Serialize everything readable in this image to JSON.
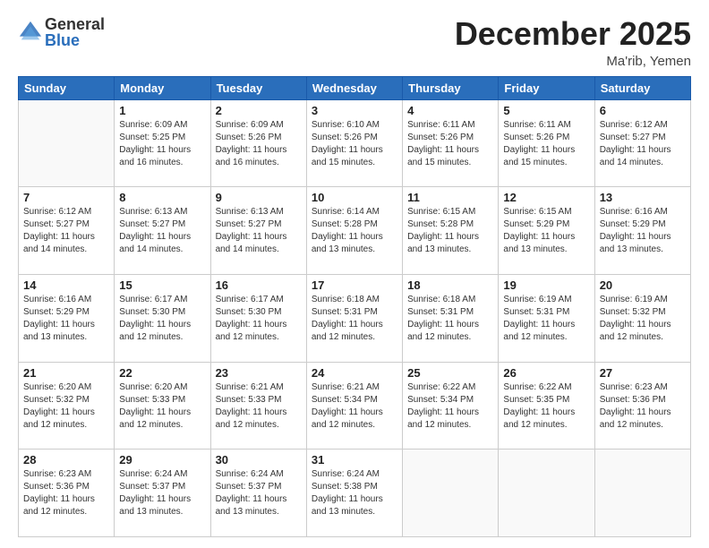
{
  "logo": {
    "general": "General",
    "blue": "Blue"
  },
  "title": "December 2025",
  "location": "Ma'rib, Yemen",
  "days_of_week": [
    "Sunday",
    "Monday",
    "Tuesday",
    "Wednesday",
    "Thursday",
    "Friday",
    "Saturday"
  ],
  "weeks": [
    [
      {
        "day": "",
        "sunrise": "",
        "sunset": "",
        "daylight": ""
      },
      {
        "day": "1",
        "sunrise": "Sunrise: 6:09 AM",
        "sunset": "Sunset: 5:25 PM",
        "daylight": "Daylight: 11 hours and 16 minutes."
      },
      {
        "day": "2",
        "sunrise": "Sunrise: 6:09 AM",
        "sunset": "Sunset: 5:26 PM",
        "daylight": "Daylight: 11 hours and 16 minutes."
      },
      {
        "day": "3",
        "sunrise": "Sunrise: 6:10 AM",
        "sunset": "Sunset: 5:26 PM",
        "daylight": "Daylight: 11 hours and 15 minutes."
      },
      {
        "day": "4",
        "sunrise": "Sunrise: 6:11 AM",
        "sunset": "Sunset: 5:26 PM",
        "daylight": "Daylight: 11 hours and 15 minutes."
      },
      {
        "day": "5",
        "sunrise": "Sunrise: 6:11 AM",
        "sunset": "Sunset: 5:26 PM",
        "daylight": "Daylight: 11 hours and 15 minutes."
      },
      {
        "day": "6",
        "sunrise": "Sunrise: 6:12 AM",
        "sunset": "Sunset: 5:27 PM",
        "daylight": "Daylight: 11 hours and 14 minutes."
      }
    ],
    [
      {
        "day": "7",
        "sunrise": "Sunrise: 6:12 AM",
        "sunset": "Sunset: 5:27 PM",
        "daylight": "Daylight: 11 hours and 14 minutes."
      },
      {
        "day": "8",
        "sunrise": "Sunrise: 6:13 AM",
        "sunset": "Sunset: 5:27 PM",
        "daylight": "Daylight: 11 hours and 14 minutes."
      },
      {
        "day": "9",
        "sunrise": "Sunrise: 6:13 AM",
        "sunset": "Sunset: 5:27 PM",
        "daylight": "Daylight: 11 hours and 14 minutes."
      },
      {
        "day": "10",
        "sunrise": "Sunrise: 6:14 AM",
        "sunset": "Sunset: 5:28 PM",
        "daylight": "Daylight: 11 hours and 13 minutes."
      },
      {
        "day": "11",
        "sunrise": "Sunrise: 6:15 AM",
        "sunset": "Sunset: 5:28 PM",
        "daylight": "Daylight: 11 hours and 13 minutes."
      },
      {
        "day": "12",
        "sunrise": "Sunrise: 6:15 AM",
        "sunset": "Sunset: 5:29 PM",
        "daylight": "Daylight: 11 hours and 13 minutes."
      },
      {
        "day": "13",
        "sunrise": "Sunrise: 6:16 AM",
        "sunset": "Sunset: 5:29 PM",
        "daylight": "Daylight: 11 hours and 13 minutes."
      }
    ],
    [
      {
        "day": "14",
        "sunrise": "Sunrise: 6:16 AM",
        "sunset": "Sunset: 5:29 PM",
        "daylight": "Daylight: 11 hours and 13 minutes."
      },
      {
        "day": "15",
        "sunrise": "Sunrise: 6:17 AM",
        "sunset": "Sunset: 5:30 PM",
        "daylight": "Daylight: 11 hours and 12 minutes."
      },
      {
        "day": "16",
        "sunrise": "Sunrise: 6:17 AM",
        "sunset": "Sunset: 5:30 PM",
        "daylight": "Daylight: 11 hours and 12 minutes."
      },
      {
        "day": "17",
        "sunrise": "Sunrise: 6:18 AM",
        "sunset": "Sunset: 5:31 PM",
        "daylight": "Daylight: 11 hours and 12 minutes."
      },
      {
        "day": "18",
        "sunrise": "Sunrise: 6:18 AM",
        "sunset": "Sunset: 5:31 PM",
        "daylight": "Daylight: 11 hours and 12 minutes."
      },
      {
        "day": "19",
        "sunrise": "Sunrise: 6:19 AM",
        "sunset": "Sunset: 5:31 PM",
        "daylight": "Daylight: 11 hours and 12 minutes."
      },
      {
        "day": "20",
        "sunrise": "Sunrise: 6:19 AM",
        "sunset": "Sunset: 5:32 PM",
        "daylight": "Daylight: 11 hours and 12 minutes."
      }
    ],
    [
      {
        "day": "21",
        "sunrise": "Sunrise: 6:20 AM",
        "sunset": "Sunset: 5:32 PM",
        "daylight": "Daylight: 11 hours and 12 minutes."
      },
      {
        "day": "22",
        "sunrise": "Sunrise: 6:20 AM",
        "sunset": "Sunset: 5:33 PM",
        "daylight": "Daylight: 11 hours and 12 minutes."
      },
      {
        "day": "23",
        "sunrise": "Sunrise: 6:21 AM",
        "sunset": "Sunset: 5:33 PM",
        "daylight": "Daylight: 11 hours and 12 minutes."
      },
      {
        "day": "24",
        "sunrise": "Sunrise: 6:21 AM",
        "sunset": "Sunset: 5:34 PM",
        "daylight": "Daylight: 11 hours and 12 minutes."
      },
      {
        "day": "25",
        "sunrise": "Sunrise: 6:22 AM",
        "sunset": "Sunset: 5:34 PM",
        "daylight": "Daylight: 11 hours and 12 minutes."
      },
      {
        "day": "26",
        "sunrise": "Sunrise: 6:22 AM",
        "sunset": "Sunset: 5:35 PM",
        "daylight": "Daylight: 11 hours and 12 minutes."
      },
      {
        "day": "27",
        "sunrise": "Sunrise: 6:23 AM",
        "sunset": "Sunset: 5:36 PM",
        "daylight": "Daylight: 11 hours and 12 minutes."
      }
    ],
    [
      {
        "day": "28",
        "sunrise": "Sunrise: 6:23 AM",
        "sunset": "Sunset: 5:36 PM",
        "daylight": "Daylight: 11 hours and 12 minutes."
      },
      {
        "day": "29",
        "sunrise": "Sunrise: 6:24 AM",
        "sunset": "Sunset: 5:37 PM",
        "daylight": "Daylight: 11 hours and 13 minutes."
      },
      {
        "day": "30",
        "sunrise": "Sunrise: 6:24 AM",
        "sunset": "Sunset: 5:37 PM",
        "daylight": "Daylight: 11 hours and 13 minutes."
      },
      {
        "day": "31",
        "sunrise": "Sunrise: 6:24 AM",
        "sunset": "Sunset: 5:38 PM",
        "daylight": "Daylight: 11 hours and 13 minutes."
      },
      {
        "day": "",
        "sunrise": "",
        "sunset": "",
        "daylight": ""
      },
      {
        "day": "",
        "sunrise": "",
        "sunset": "",
        "daylight": ""
      },
      {
        "day": "",
        "sunrise": "",
        "sunset": "",
        "daylight": ""
      }
    ]
  ]
}
